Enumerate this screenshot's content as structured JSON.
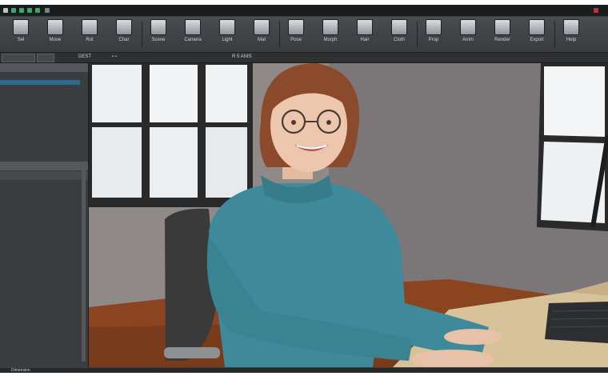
{
  "ribbon": {
    "buttons": [
      {
        "label": "Sel",
        "icon": "cursor-icon"
      },
      {
        "label": "Move",
        "icon": "move-icon"
      },
      {
        "label": "Rot",
        "icon": "rotate-icon"
      },
      {
        "label": "Char",
        "icon": "figure-icon"
      },
      {
        "label": "Scene",
        "icon": "scene-icon"
      },
      {
        "label": "Camera",
        "icon": "camera-icon"
      },
      {
        "label": "Light",
        "icon": "light-icon"
      },
      {
        "label": "Mat",
        "icon": "material-icon"
      },
      {
        "label": "Pose",
        "icon": "pose-icon"
      },
      {
        "label": "Morph",
        "icon": "morph-icon"
      },
      {
        "label": "Hair",
        "icon": "hair-icon"
      },
      {
        "label": "Cloth",
        "icon": "cloth-icon"
      },
      {
        "label": "Prop",
        "icon": "prop-icon"
      },
      {
        "label": "Anim",
        "icon": "animation-icon"
      },
      {
        "label": "Render",
        "icon": "render-icon"
      },
      {
        "label": "Export",
        "icon": "export-icon"
      },
      {
        "label": "Help",
        "icon": "help-icon"
      }
    ]
  },
  "subbar": {
    "field_left": "",
    "label_1": "DEST",
    "label_2": "R 5 ANIS"
  },
  "left_panel": {
    "header_1": "",
    "header_2": "",
    "header_3": ""
  },
  "status": {
    "text": "Dimension"
  },
  "colors": {
    "accent": "#2f6a8c",
    "sweater": "#3f8a9a",
    "wall": "#8d8886",
    "floor": "#7a3d1f",
    "desk": "#d8c39a"
  }
}
